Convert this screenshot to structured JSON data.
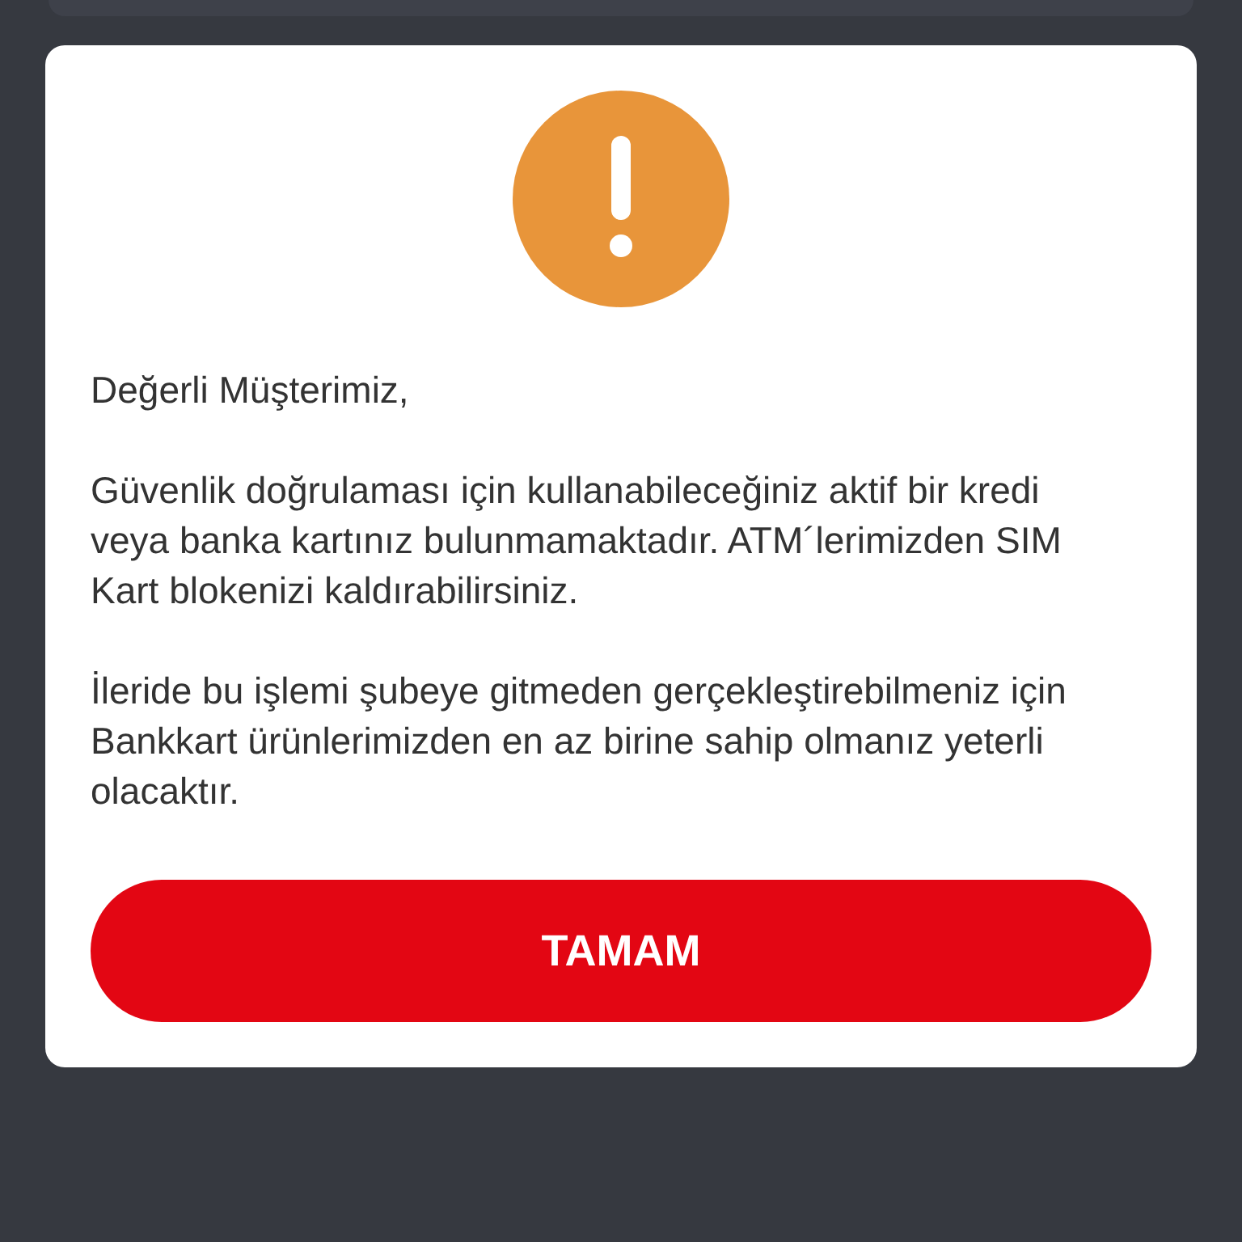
{
  "dialog": {
    "greeting": "Değerli Müşterimiz,",
    "paragraphs": [
      "Güvenlik doğrulaması için kullanabileceğiniz aktif bir kredi veya banka kartınız bulunmamaktadır. ATM´lerimizden SIM Kart blokenizi kaldırabilirsiniz.",
      "İleride bu işlemi şubeye gitmeden gerçekleştirebilmeniz için Bankkart ürünlerimizden en az birine sahip olmanız yeterli olacaktır."
    ],
    "button": "TAMAM"
  }
}
